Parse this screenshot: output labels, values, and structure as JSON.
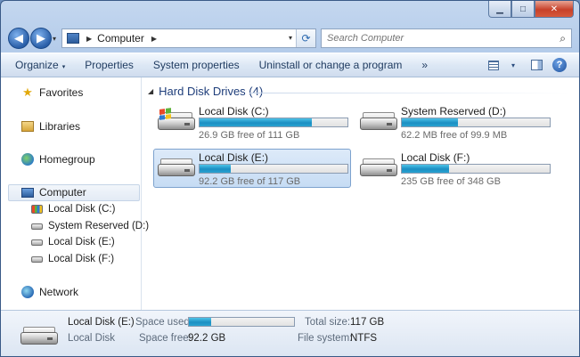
{
  "window": {
    "caption_buttons": {
      "minimize": "▁",
      "maximize": "□",
      "close": "✕"
    }
  },
  "navbar": {
    "back": "◀",
    "forward": "▶",
    "history_dropdown": "▾",
    "address": {
      "crumb_separator": "▶",
      "crumb": "Computer",
      "trail_separator": "▶",
      "dropdown": "▾",
      "refresh": "⟳"
    },
    "search": {
      "placeholder": "Search Computer",
      "icon": "⌕"
    }
  },
  "toolbar": {
    "items": [
      "Organize",
      "Properties",
      "System properties",
      "Uninstall or change a program",
      "»"
    ],
    "organize_arrow": "▾",
    "view_arrow": "▾",
    "help": "?"
  },
  "sidebar": {
    "favorites": "Favorites",
    "libraries": "Libraries",
    "homegroup": "Homegroup",
    "computer": "Computer",
    "computer_children": [
      "Local Disk (C:)",
      "System Reserved (D:)",
      "Local Disk (E:)",
      "Local Disk (F:)"
    ],
    "network": "Network",
    "favorites_icon": "★"
  },
  "content": {
    "group_title": "Hard Disk Drives (4)",
    "group_toggle": "◢",
    "drives": [
      {
        "name": "Local Disk (C:)",
        "free_text": "26.9 GB free of 111 GB",
        "used_fraction": 0.76
      },
      {
        "name": "System Reserved (D:)",
        "free_text": "62.2 MB free of 99.9 MB",
        "used_fraction": 0.38
      },
      {
        "name": "Local Disk (E:)",
        "free_text": "92.2 GB free of 117 GB",
        "used_fraction": 0.21
      },
      {
        "name": "Local Disk (F:)",
        "free_text": "235 GB free of 348 GB",
        "used_fraction": 0.32
      }
    ]
  },
  "details": {
    "name": "Local Disk (E:)",
    "type": "Local Disk",
    "space_used_label": "Space used:",
    "space_used_fraction": 0.21,
    "space_free_label": "Space free:",
    "space_free_value": "92.2 GB",
    "total_size_label": "Total size:",
    "total_size_value": "117 GB",
    "file_system_label": "File system:",
    "file_system_value": "NTFS"
  },
  "colors": {
    "accent": "#1b8ec2",
    "selection": "#c6dcf4",
    "group_title": "#1e3d7a"
  }
}
